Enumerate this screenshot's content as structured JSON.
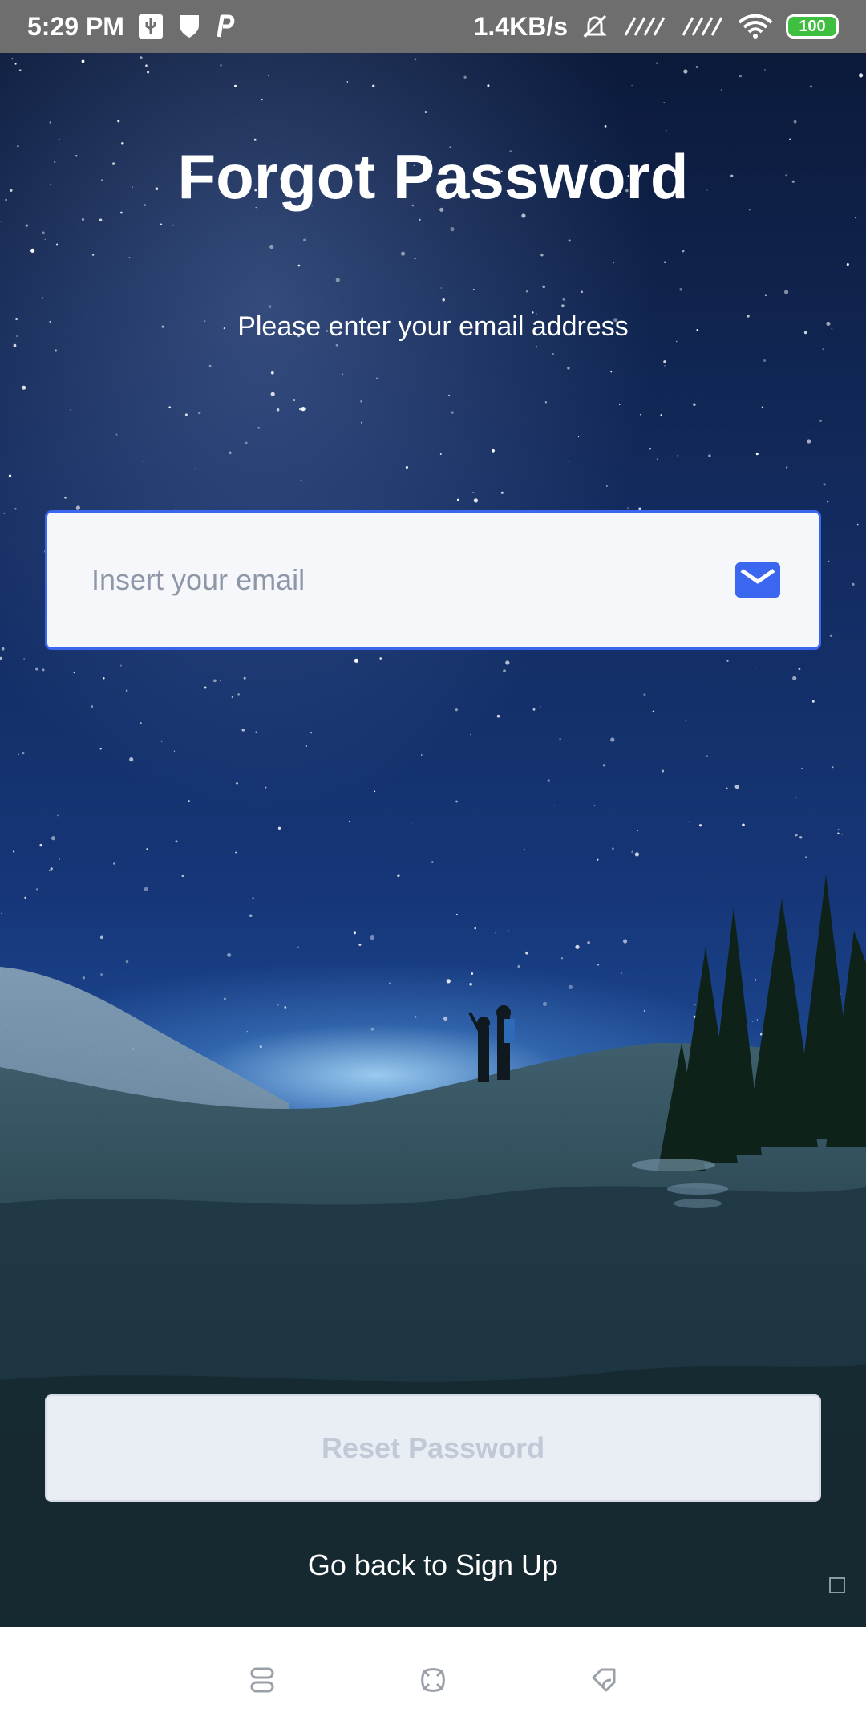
{
  "status_bar": {
    "time": "5:29 PM",
    "left_icons": [
      "usb-icon",
      "shield-icon",
      "p-app-icon"
    ],
    "net_speed": "1.4KB/s",
    "right_icons": [
      "muted-alarm-icon",
      "signal-icon",
      "signal-icon",
      "wifi-icon"
    ],
    "battery": "100"
  },
  "page": {
    "title": "Forgot Password",
    "subtitle": "Please enter your email address"
  },
  "email_field": {
    "placeholder": "Insert your email",
    "value": "",
    "icon": "mail-icon",
    "border_color": "#3b66f0"
  },
  "reset_button": {
    "label": "Reset Password",
    "enabled": false
  },
  "back_link": {
    "label": "Go back to Sign Up"
  },
  "nav_bar": {
    "items": [
      "recents-icon",
      "home-icon",
      "back-icon"
    ]
  },
  "colors": {
    "accent": "#3b66f0",
    "status_bar_bg": "#6e6e6e",
    "battery": "#3fbf3f"
  }
}
